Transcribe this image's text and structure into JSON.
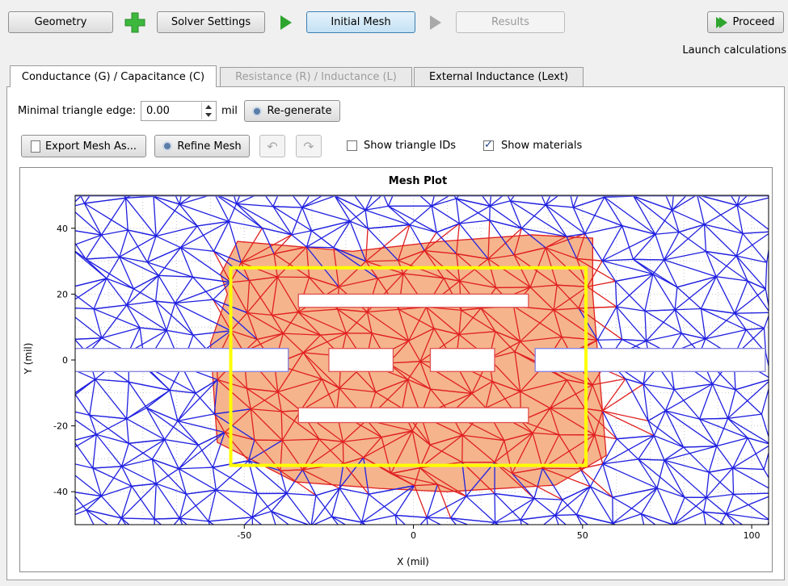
{
  "workflow": {
    "geometry": "Geometry",
    "solver_settings": "Solver Settings",
    "initial_mesh": "Initial Mesh",
    "results": "Results",
    "proceed": "Proceed",
    "launch_hint": "Launch calculations"
  },
  "tabs": [
    "Conductance (G) / Capacitance (C)",
    "Resistance (R) / Inductance (L)",
    "External Inductance (Lext)"
  ],
  "controls": {
    "min_edge_label": "Minimal triangle edge:",
    "min_edge_value": "0.00",
    "unit": "mil",
    "regenerate": "Re-generate",
    "export": "Export Mesh As...",
    "refine": "Refine Mesh",
    "show_ids": "Show triangle IDs",
    "show_ids_checked": false,
    "show_materials": "Show materials",
    "show_materials_checked": true
  },
  "chart_data": {
    "type": "mesh",
    "title": "Mesh Plot",
    "xlabel": "X (mil)",
    "ylabel": "Y (mil)",
    "xlim": [
      -100,
      105
    ],
    "ylim": [
      -50,
      50
    ],
    "xticks": [
      -50,
      0,
      50,
      100
    ],
    "yticks": [
      -40,
      -20,
      0,
      20,
      40
    ],
    "colors": {
      "outer_mesh": "#2020e0",
      "inner_mesh": "#e02020",
      "dielectric_fill": "#f5b48c",
      "highlight": "#ffff00"
    }
  }
}
